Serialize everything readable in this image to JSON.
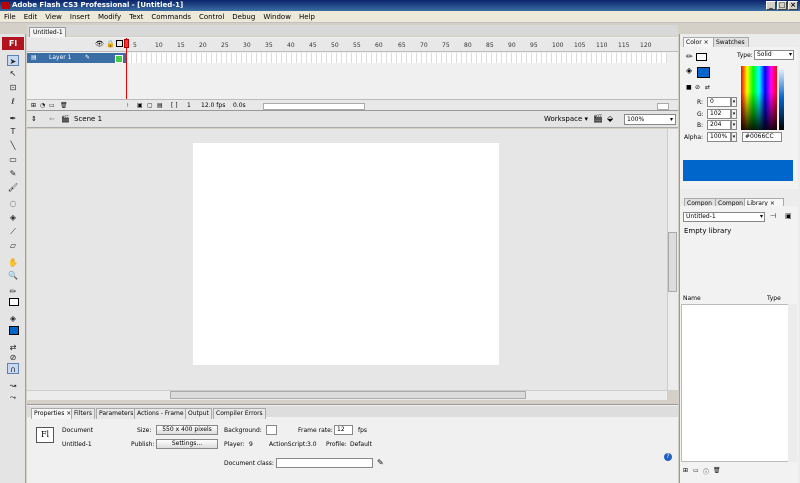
{
  "window": {
    "title": "Adobe Flash CS3 Professional - [Untitled-1]",
    "min": "_",
    "max": "□",
    "close": "×"
  },
  "menu": [
    "File",
    "Edit",
    "View",
    "Insert",
    "Modify",
    "Text",
    "Commands",
    "Control",
    "Debug",
    "Window",
    "Help"
  ],
  "logo": "Fl",
  "doc_tab": "Untitled-1",
  "timeline": {
    "ruler": [
      "5",
      "10",
      "15",
      "20",
      "25",
      "30",
      "35",
      "40",
      "45",
      "50",
      "55",
      "60",
      "65",
      "70",
      "75",
      "80",
      "85",
      "90",
      "95",
      "100",
      "105",
      "110",
      "115",
      "120"
    ],
    "layer_name": "Layer 1",
    "current_frame": "1",
    "fps": "12.0 fps",
    "time": "0.0s"
  },
  "editbar": {
    "scene": "Scene 1",
    "workspace": "Workspace",
    "zoom": "100%"
  },
  "properties": {
    "tabs": [
      "Properties",
      "Filters",
      "Parameters",
      "Actions - Frame",
      "Output",
      "Compiler Errors"
    ],
    "doc_type": "Document",
    "doc_name": "Untitled-1",
    "size_label": "Size:",
    "size_value": "550 x 400 pixels",
    "background_label": "Background:",
    "framerate_label": "Frame rate:",
    "framerate_value": "12",
    "fps_unit": "fps",
    "publish_label": "Publish:",
    "settings_btn": "Settings...",
    "player_label": "Player:",
    "player_value": "9",
    "actionscript_label": "ActionScript:",
    "actionscript_value": "3.0",
    "profile_label": "Profile:",
    "profile_value": "Default",
    "docclass_label": "Document class:",
    "docclass_value": ""
  },
  "color_panel": {
    "tabs": [
      "Color",
      "Swatches"
    ],
    "type_label": "Type:",
    "type_value": "Solid",
    "r_label": "R:",
    "r_value": "0",
    "g_label": "G:",
    "g_value": "102",
    "b_label": "B:",
    "b_value": "204",
    "alpha_label": "Alpha:",
    "alpha_value": "100%",
    "hex": "#0066CC",
    "color": "#0066cc"
  },
  "library_panel": {
    "tabs": [
      "Compon",
      "Compon",
      "Library"
    ],
    "doc": "Untitled-1",
    "empty": "Empty library",
    "col_name": "Name",
    "col_type": "Type"
  }
}
